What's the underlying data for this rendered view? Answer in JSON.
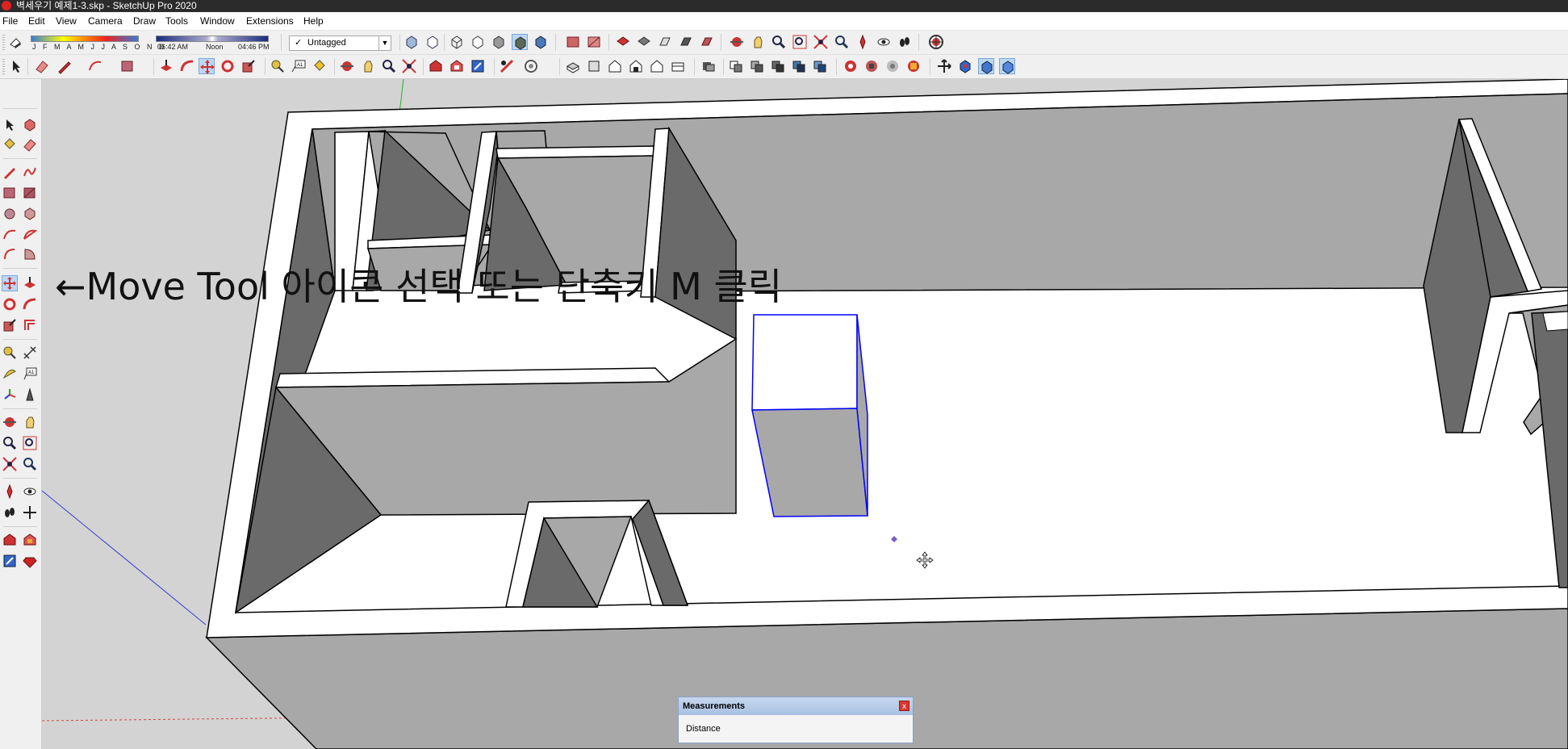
{
  "window": {
    "title": "벽세우기 예제1-3.skp - SketchUp Pro 2020"
  },
  "menu": [
    "File",
    "Edit",
    "View",
    "Camera",
    "Draw",
    "Tools",
    "Window",
    "Extensions",
    "Help"
  ],
  "shadows": {
    "months_label": "J F M A M J J A S O N D",
    "time_start": "06:42 AM",
    "time_mid": "Noon",
    "time_end": "04:46 PM"
  },
  "tags": {
    "current": "Untagged"
  },
  "instruction": "←Move Tool 아이콘 선택 또는 단축키 M 클릭",
  "measurements": {
    "title": "Measurements",
    "label": "Distance",
    "close": "x"
  },
  "colors": {
    "wall_top": "#ffffff",
    "wall_light": "#a8a8a8",
    "wall_dark": "#6a6a6a",
    "floor": "#ffffff",
    "sky": "#d3d3d3",
    "selection": "#0000ff",
    "axis_green": "#2cae2c",
    "axis_blue": "#3b3bd8",
    "axis_red": "#d94040"
  },
  "toolbar_icons": {
    "row1": [
      "eraser-icon",
      "shadow-toggle-icon",
      "xray-icon",
      "back-edges-icon",
      "wireframe-icon",
      "hidden-line-icon",
      "shaded-icon",
      "shaded-texture-icon",
      "monochrome-icon",
      "materials-icon",
      "styles-icon",
      "section-plane-icon",
      "section-display-icon",
      "section-cut-icon",
      "section-fill-icon",
      "orbit-icon",
      "pan-icon",
      "zoom-icon",
      "zoom-window-icon",
      "zoom-extents-icon",
      "previous-view-icon",
      "position-camera-icon",
      "look-around-icon",
      "walk-icon",
      "geo-location-icon"
    ],
    "row2": [
      "select-icon",
      "eraser-icon",
      "pencil-icon",
      "arc-icon",
      "rectangle-icon",
      "push-pull-icon",
      "follow-me-icon",
      "move-icon",
      "rotate-icon",
      "scale-icon",
      "tape-measure-icon",
      "text-icon",
      "paint-bucket-icon",
      "orbit-icon",
      "pan-icon",
      "zoom-icon",
      "zoom-extents-icon",
      "warehouse-icon",
      "extension-warehouse-icon",
      "layout-icon",
      "model-info-icon",
      "add-location-icon",
      "iso-view-icon",
      "top-view-icon",
      "front-view-icon",
      "right-view-icon",
      "back-view-icon",
      "left-view-icon",
      "outliner-icon",
      "components-icon",
      "materials-icon",
      "styles-icon",
      "tags-icon",
      "scenes-icon",
      "shadows-icon",
      "fog-icon",
      "match-photo-icon",
      "edge-style-icon",
      "axes-icon",
      "section-plane-icon",
      "display-section-icon",
      "section-cuts-icon"
    ]
  },
  "left_tools": [
    "select-icon",
    "make-component-icon",
    "paint-bucket-icon",
    "eraser-icon",
    "line-icon",
    "freehand-icon",
    "rectangle-icon",
    "rotated-rectangle-icon",
    "circle-icon",
    "polygon-icon",
    "arc-icon",
    "two-point-arc-icon",
    "three-point-arc-icon",
    "pie-icon",
    "move-icon",
    "push-pull-icon",
    "rotate-icon",
    "follow-me-icon",
    "scale-icon",
    "offset-icon",
    "tape-measure-icon",
    "dimension-icon",
    "protractor-icon",
    "text-icon",
    "axes-icon",
    "3d-text-icon",
    "orbit-icon",
    "pan-icon",
    "zoom-icon",
    "zoom-window-icon",
    "zoom-extents-icon",
    "previous-icon",
    "position-camera-icon",
    "look-around-icon",
    "walk-icon",
    "section-plane-icon",
    "warehouse-icon",
    "extension-icon",
    "send-to-layout-icon",
    "ruby-icon"
  ]
}
